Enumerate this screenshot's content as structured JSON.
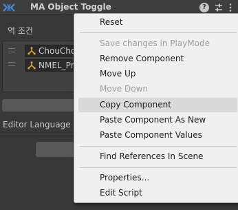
{
  "header": {
    "title": "MA Object Toggle",
    "help_glyph": "?",
    "logo_icon": "ma-logo-icon",
    "preset_icon": "sliders-icon",
    "more_icon": "kebab-menu-icon"
  },
  "inspector": {
    "section_label": "역 조건",
    "objects": [
      {
        "name": "ChouChou",
        "icon": "gameobject-icon"
      },
      {
        "name": "NMEL_Pm",
        "icon": "gameobject-icon"
      }
    ],
    "editor_language_label": "Editor Language"
  },
  "context_menu": {
    "items": [
      {
        "label": "Reset",
        "enabled": true
      },
      {
        "label": "Save changes in PlayMode",
        "enabled": false
      },
      {
        "label": "Remove Component",
        "enabled": true
      },
      {
        "label": "Move Up",
        "enabled": true
      },
      {
        "label": "Move Down",
        "enabled": false
      },
      {
        "label": "Copy Component",
        "enabled": true,
        "highlighted": true
      },
      {
        "label": "Paste Component As New",
        "enabled": true
      },
      {
        "label": "Paste Component Values",
        "enabled": true
      },
      {
        "label": "Find References In Scene",
        "enabled": true
      },
      {
        "label": "Properties...",
        "enabled": true
      },
      {
        "label": "Edit Script",
        "enabled": true
      }
    ]
  },
  "colors": {
    "logo_accent": "#3f8ee6",
    "gameobject_icon": "#e0a03c",
    "menu_background": "#f0f0f0",
    "menu_highlight": "#dadada",
    "menu_disabled_text": "#9e9e9e"
  }
}
